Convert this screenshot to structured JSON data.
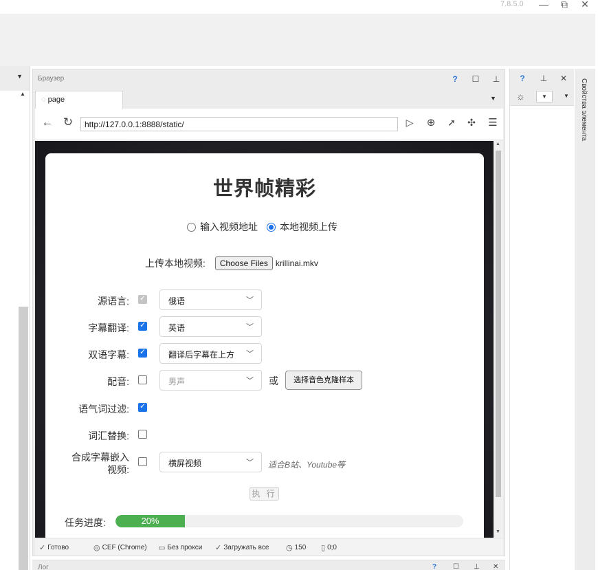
{
  "window": {
    "version": "7.8.5.0",
    "minimize_glyph": "—",
    "restore_glyph": "⧉",
    "close_glyph": "✕"
  },
  "browser_panel": {
    "title": "Браузер",
    "help": "?",
    "maximize": "☐",
    "pin": "⊥",
    "close": "✕",
    "tab_label": "page",
    "address": "http://127.0.0.1:8888/static/"
  },
  "page": {
    "title": "世界帧精彩",
    "source_options": [
      "输入视频地址",
      "本地视频上传"
    ],
    "selected_source": "本地视频上传",
    "upload_label": "上传本地视频:",
    "file_button": "Choose Files",
    "file_name": "krillinai.mkv",
    "rows": [
      {
        "label": "源语言:",
        "checked": true,
        "disabled": true,
        "select": "俄语"
      },
      {
        "label": "字幕翻译:",
        "checked": true,
        "select": "英语"
      },
      {
        "label": "双语字幕:",
        "checked": true,
        "select": "翻译后字幕在上方"
      },
      {
        "label": "配音:",
        "checked": false,
        "select": "男声",
        "or": "或",
        "button": "选择音色克隆样本"
      },
      {
        "label": "语气词过滤:",
        "checked": true
      },
      {
        "label": "词汇替换:",
        "checked": false
      },
      {
        "label_line1": "合成字幕嵌入",
        "label_line2": "视频:",
        "checked": false,
        "select": "横屏视频",
        "hint": "适合B站、Youtube等"
      }
    ],
    "execute_button": "执 行",
    "progress_label": "任务进度:",
    "progress_value": 20,
    "progress_text": "20%"
  },
  "status_bar": {
    "ready": "Готово",
    "engine": "CEF (Chrome)",
    "proxy": "Без прокси",
    "load": "Загружать все",
    "timeout": "150",
    "coords": "0;0"
  },
  "right_panel": {
    "help": "?",
    "pin": "⊥",
    "close": "✕",
    "vertical_tab": "Свойства элемента"
  },
  "log_panel": {
    "title": "Лог"
  }
}
